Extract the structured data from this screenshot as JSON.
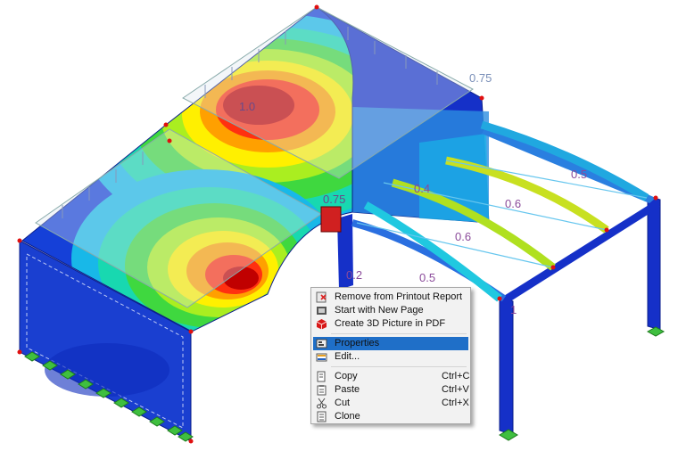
{
  "viewport": {
    "labels": {
      "top_right": "0.75",
      "crest": "1.0",
      "mid": "0.75",
      "lower": "0.2",
      "beam_a": "0.4",
      "beam_b": "0.6",
      "beam_c": "0.5",
      "beam_d": "0.6",
      "beam_e": "0.5",
      "beam_f": "1"
    }
  },
  "context_menu": {
    "items": [
      {
        "label": "Remove from Printout Report",
        "icon": "remove-report-icon",
        "shortcut": ""
      },
      {
        "label": "Start with New Page",
        "icon": "new-page-icon",
        "shortcut": ""
      },
      {
        "label": "Create 3D Picture in PDF",
        "icon": "pdf-3d-icon",
        "shortcut": ""
      },
      {
        "label": "Properties",
        "icon": "properties-icon",
        "shortcut": ""
      },
      {
        "label": "Edit...",
        "icon": "edit-icon",
        "shortcut": ""
      },
      {
        "label": "Copy",
        "icon": "copy-icon",
        "shortcut": "Ctrl+C"
      },
      {
        "label": "Paste",
        "icon": "paste-icon",
        "shortcut": "Ctrl+V"
      },
      {
        "label": "Cut",
        "icon": "cut-icon",
        "shortcut": "Ctrl+X"
      },
      {
        "label": "Clone",
        "icon": "clone-icon",
        "shortcut": ""
      }
    ],
    "highlighted": "Properties",
    "colors": {
      "highlight": "#1f6fc8",
      "background": "#f2f2f2"
    }
  }
}
